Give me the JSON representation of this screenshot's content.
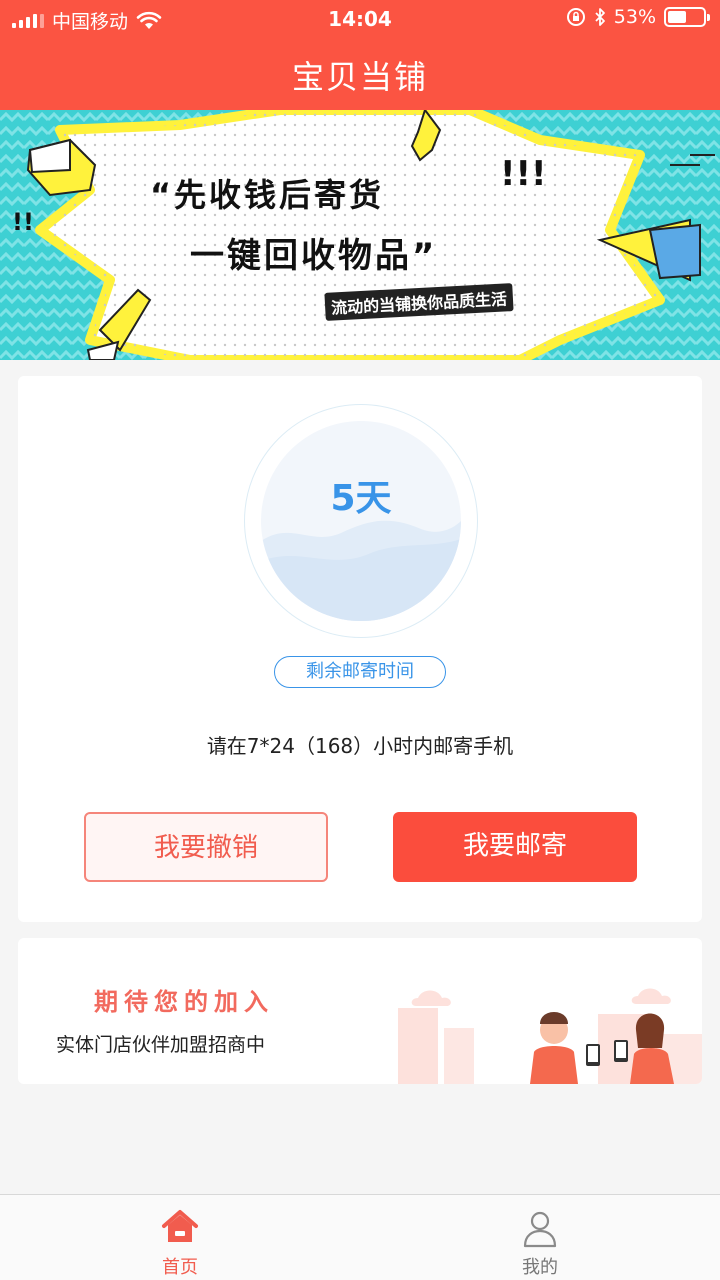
{
  "status_bar": {
    "carrier": "中国移动",
    "time": "14:04",
    "battery_percent": "53%",
    "battery_level": 0.53
  },
  "header": {
    "title": "宝贝当铺"
  },
  "banner": {
    "line1": "“先收钱后寄货",
    "line2": "一键回收物品”",
    "line3": "流动的当铺换你品质生活"
  },
  "countdown": {
    "value": "5天",
    "pill_label": "剩余邮寄时间",
    "instruction": "请在7*24（168）小时内邮寄手机"
  },
  "actions": {
    "cancel_label": "我要撤销",
    "send_label": "我要邮寄"
  },
  "promo": {
    "title": "期待您的加入",
    "subtitle": "实体门店伙伴加盟招商中"
  },
  "tabbar": {
    "home_label": "首页",
    "me_label": "我的",
    "active": "home"
  },
  "colors": {
    "brand": "#fb5442",
    "accent_blue": "#3994e8",
    "banner_cyan": "#3ed0d3",
    "banner_yellow": "#fff23c"
  }
}
